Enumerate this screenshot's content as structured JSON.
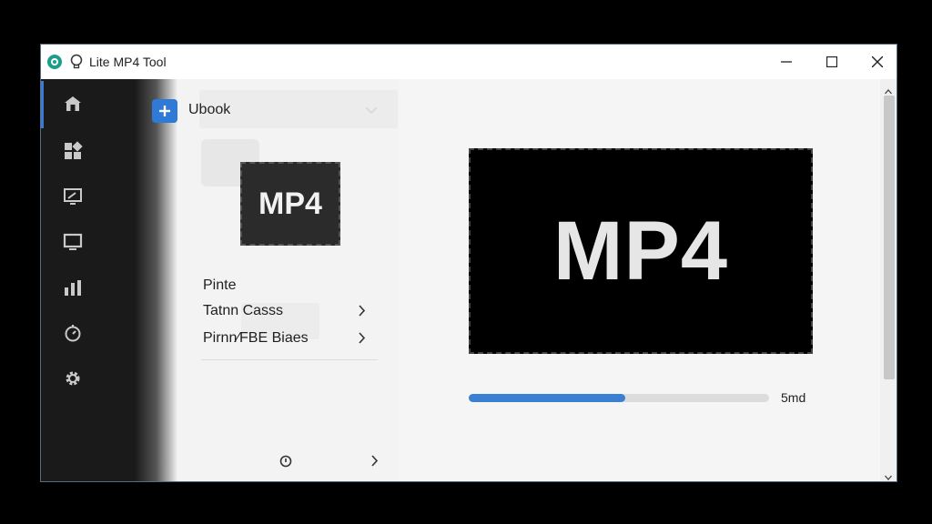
{
  "window": {
    "title": "Lite MP4 Tool",
    "controls": {
      "minimize": "minimize",
      "maximize": "maximize",
      "close": "close"
    }
  },
  "rail": {
    "items": [
      {
        "icon": "home-icon",
        "active": true
      },
      {
        "icon": "grid-icon"
      },
      {
        "icon": "screen-capture-icon"
      },
      {
        "icon": "monitor-icon"
      },
      {
        "icon": "chart-icon"
      },
      {
        "icon": "timer-icon"
      },
      {
        "icon": "gear-icon"
      }
    ],
    "expand_icon": "chevron-right-icon"
  },
  "panel": {
    "dropdown_label": "Ubook",
    "thumbnail_label": "MP4",
    "menu_title": "Pinte",
    "menu_items": [
      {
        "label": "Tatnn Casss"
      },
      {
        "label": "Pirnn∕FBE Biaes"
      }
    ]
  },
  "preview": {
    "label": "MP4"
  },
  "progress": {
    "value_fraction": 0.52,
    "text": "5md"
  },
  "colors": {
    "accent": "#3a80d2",
    "rail_bg": "#1a1a1a",
    "preview_bg": "#000000"
  }
}
